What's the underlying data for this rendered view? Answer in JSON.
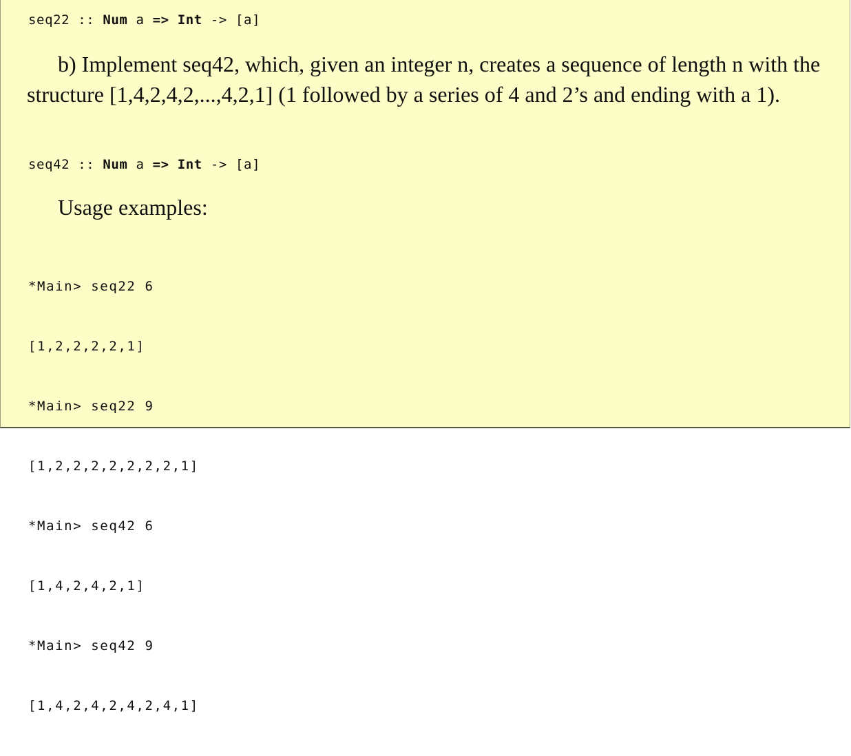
{
  "signature_seq22": {
    "name": "seq22",
    "sep": " :: ",
    "constraint": "Num",
    "var": " a ",
    "arrow1": "=>",
    "int": " Int",
    "arrow2": " -> ",
    "ret": "[a]"
  },
  "paragraph_b": "b) Implement seq42, which, given an integer n, creates a sequence of length n with the structure [1,4,2,4,2,...,4,2,1] (1 followed by a series of 4 and 2’s and ending with a 1).",
  "signature_seq42": {
    "name": "seq42",
    "sep": " :: ",
    "constraint": "Num",
    "var": " a ",
    "arrow1": "=>",
    "int": " Int",
    "arrow2": " -> ",
    "ret": "[a]"
  },
  "usage_heading": "Usage examples:",
  "examples": [
    "*Main> seq22 6",
    "[1,2,2,2,2,1]",
    "*Main> seq22 9",
    "[1,2,2,2,2,2,2,2,1]",
    "*Main> seq42 6",
    "[1,4,2,4,2,1]",
    "*Main> seq42 9",
    "[1,4,2,4,2,4,2,4,1]"
  ],
  "colors": {
    "background": "#fdfdc8",
    "text": "#111111"
  }
}
